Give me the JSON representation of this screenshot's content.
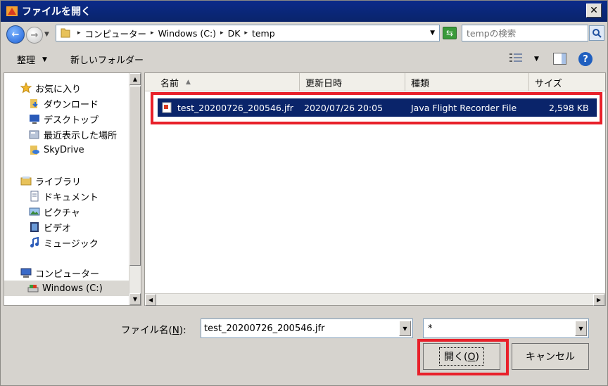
{
  "window": {
    "title": "ファイルを開く",
    "close_label": "✕"
  },
  "address": {
    "crumbs": [
      "コンピューター",
      "Windows (C:)",
      "DK",
      "temp"
    ],
    "search_placeholder": "tempの検索"
  },
  "toolbar": {
    "organize_label": "整理",
    "new_folder_label": "新しいフォルダー",
    "help_label": "?"
  },
  "sidebar": {
    "favorites_label": "お気に入り",
    "favorites": [
      "ダウンロード",
      "デスクトップ",
      "最近表示した場所",
      "SkyDrive"
    ],
    "libraries_label": "ライブラリ",
    "libraries": [
      "ドキュメント",
      "ピクチャ",
      "ビデオ",
      "ミュージック"
    ],
    "computer_label": "コンピューター",
    "computer_items": [
      "Windows (C:)"
    ]
  },
  "file_list": {
    "columns": [
      "名前",
      "更新日時",
      "種類",
      "サイズ"
    ],
    "rows": [
      {
        "name": "test_20200726_200546.jfr",
        "modified": "2020/07/26 20:05",
        "type": "Java Flight Recorder File",
        "size": "2,598 KB"
      }
    ]
  },
  "footer": {
    "filename_label_prefix": "ファイル名(",
    "filename_label_key": "N",
    "filename_label_suffix": "):",
    "filename_value": "test_20200726_200546.jfr",
    "filetype_value": "*",
    "open_label_prefix": "開く(",
    "open_label_key": "O",
    "open_label_suffix": ")",
    "cancel_label": "キャンセル"
  },
  "colors": {
    "highlight": "#e8202a",
    "selection": "#0a246a",
    "titlebar": "#0a246a"
  }
}
